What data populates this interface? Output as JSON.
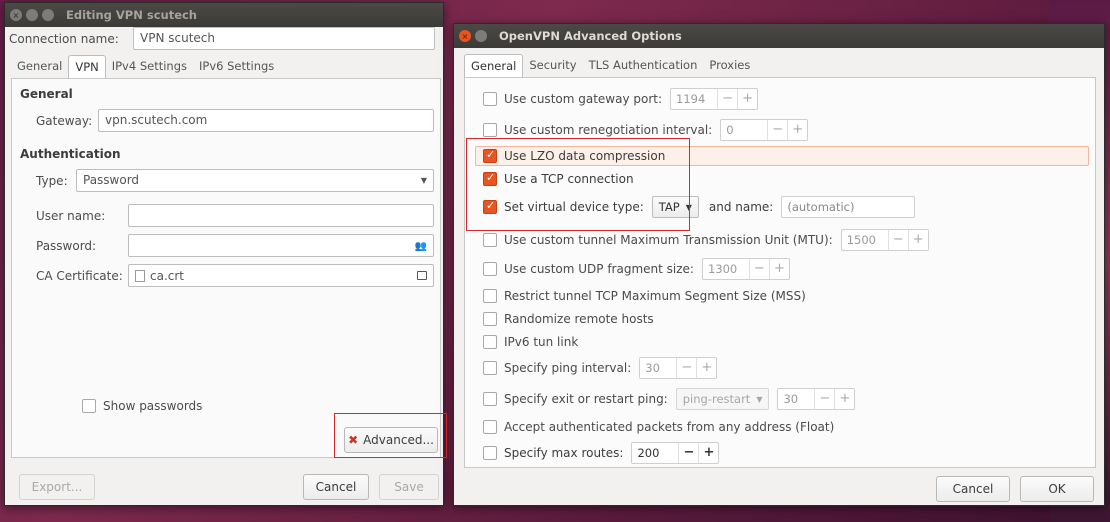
{
  "vpn_window": {
    "title": "Editing VPN scutech",
    "connection_name_label": "Connection name:",
    "connection_name_value": "VPN scutech",
    "tabs": [
      {
        "label": "General"
      },
      {
        "label": "VPN"
      },
      {
        "label": "IPv4 Settings"
      },
      {
        "label": "IPv6 Settings"
      }
    ],
    "general_heading": "General",
    "gateway_label": "Gateway:",
    "gateway_value": "vpn.scutech.com",
    "auth_heading": "Authentication",
    "type_label": "Type:",
    "type_value": "Password",
    "username_label": "User name:",
    "password_label": "Password:",
    "ca_label": "CA Certificate:",
    "ca_value": "ca.crt",
    "show_passwords": "Show passwords",
    "advanced_button": "Advanced...",
    "export_button": "Export...",
    "cancel_button": "Cancel",
    "save_button": "Save"
  },
  "adv_window": {
    "title": "OpenVPN Advanced Options",
    "tabs": [
      {
        "label": "General"
      },
      {
        "label": "Security"
      },
      {
        "label": "TLS Authentication"
      },
      {
        "label": "Proxies"
      }
    ],
    "options": {
      "gateway_port": {
        "label": "Use custom gateway port:",
        "value": "1194"
      },
      "reneg": {
        "label": "Use custom renegotiation interval:",
        "value": "0"
      },
      "lzo": {
        "label": "Use LZO data compression"
      },
      "tcp": {
        "label": "Use a TCP connection"
      },
      "vdev": {
        "label": "Set virtual device type:",
        "value": "TAP",
        "name_label": "and name:",
        "name_placeholder": "(automatic)"
      },
      "mtu": {
        "label": "Use custom tunnel Maximum Transmission Unit (MTU):",
        "value": "1500"
      },
      "udp_frag": {
        "label": "Use custom UDP fragment size:",
        "value": "1300"
      },
      "mss": {
        "label": "Restrict tunnel TCP Maximum Segment Size (MSS)"
      },
      "randomize": {
        "label": "Randomize remote hosts"
      },
      "ipv6": {
        "label": "IPv6 tun link"
      },
      "ping": {
        "label": "Specify ping interval:",
        "value": "30"
      },
      "exit_ping": {
        "label": "Specify exit or restart ping:",
        "mode": "ping-restart",
        "value": "30"
      },
      "float": {
        "label": "Accept authenticated packets from any address (Float)"
      },
      "max_routes": {
        "label": "Specify max routes:",
        "value": "200"
      }
    },
    "cancel_button": "Cancel",
    "ok_button": "OK"
  },
  "colors": {
    "accent": "#e95420",
    "highlight_box": "#d9282b"
  },
  "spin_minus": "−",
  "spin_plus": "+"
}
